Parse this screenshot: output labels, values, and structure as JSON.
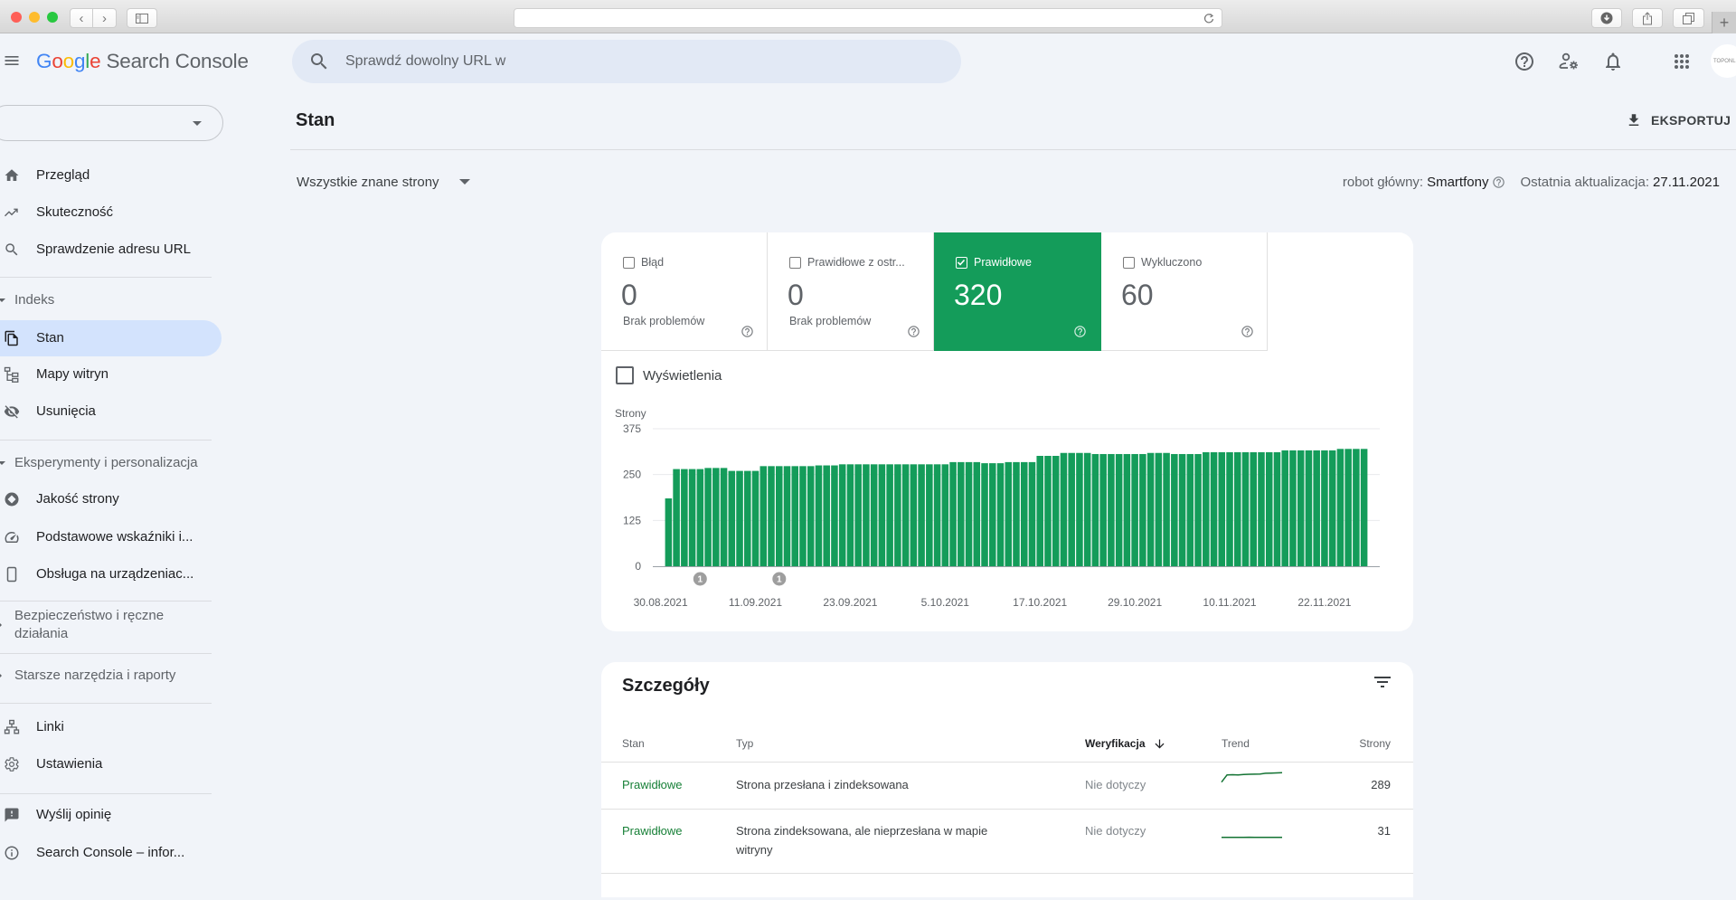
{
  "browser": {
    "address_value": "",
    "traffic_lights": {
      "close": "#fe5f57",
      "minimize": "#febc2e",
      "zoom": "#28c840"
    }
  },
  "header": {
    "logo": {
      "letters": [
        {
          "ch": "G",
          "color": "#4285f4"
        },
        {
          "ch": "o",
          "color": "#ea4335"
        },
        {
          "ch": "o",
          "color": "#fbbc05"
        },
        {
          "ch": "g",
          "color": "#4285f4"
        },
        {
          "ch": "l",
          "color": "#34a853"
        },
        {
          "ch": "e",
          "color": "#ea4335"
        }
      ],
      "product": "Search Console"
    },
    "search": {
      "placeholder": "Sprawdź dowolny URL w",
      "value": ""
    },
    "icons": [
      "help-icon",
      "manage-accounts-icon",
      "notifications-icon",
      "apps-icon"
    ],
    "avatar_text": "TOPONLIN"
  },
  "sidebar": {
    "property_value": "",
    "items": [
      {
        "label": "Przegląd",
        "icon": "home-icon"
      },
      {
        "label": "Skuteczność",
        "icon": "performance-icon"
      },
      {
        "label": "Sprawdzenie adresu URL",
        "icon": "search-icon"
      },
      {
        "label": "Stan",
        "icon": "coverage-icon",
        "active": true
      },
      {
        "label": "Mapy witryn",
        "icon": "sitemap-icon"
      },
      {
        "label": "Usunięcia",
        "icon": "removals-icon"
      },
      {
        "label": "Jakość strony",
        "icon": "page-experience-icon"
      },
      {
        "label": "Podstawowe wskaźniki i...",
        "icon": "core-web-vitals-icon"
      },
      {
        "label": "Obsługa na urządzeniac...",
        "icon": "mobile-icon"
      },
      {
        "label": "Linki",
        "icon": "links-icon"
      },
      {
        "label": "Ustawienia",
        "icon": "settings-icon"
      },
      {
        "label": "Wyślij opinię",
        "icon": "feedback-icon"
      },
      {
        "label": "Search Console – infor...",
        "icon": "info-icon"
      }
    ],
    "sections": [
      {
        "title": "Indeks",
        "expanded": true
      },
      {
        "title": "Eksperymenty i personalizacja",
        "expanded": true
      },
      {
        "title": "Bezpieczeństwo i ręczne działania",
        "expanded": false
      },
      {
        "title": "Starsze narzędzia i raporty",
        "expanded": false
      }
    ]
  },
  "page": {
    "title": "Stan",
    "export_label": "EKSPORTUJ",
    "filter_selected": "Wszystkie znane strony",
    "crawler_label": "robot główny:",
    "crawler_value": "Smartfony",
    "updated_label": "Ostatnia aktualizacja:",
    "updated_value": "27.11.2021"
  },
  "summary_tabs": [
    {
      "label": "Błąd",
      "value": "0",
      "sub": "Brak problemów",
      "checked": false
    },
    {
      "label": "Prawidłowe z ostr...",
      "value": "0",
      "sub": "Brak problemów",
      "checked": false
    },
    {
      "label": "Prawidłowe",
      "value": "320",
      "sub": "",
      "checked": true
    },
    {
      "label": "Wykluczono",
      "value": "60",
      "sub": "",
      "checked": false
    }
  ],
  "impressions_toggle": {
    "label": "Wyświetlenia",
    "checked": false
  },
  "colors": {
    "valid_green": "#149c5a",
    "active_nav": "#d3e3fd",
    "page_bg": "#f1f4f9",
    "annotation_gray": "#9e9e9e"
  },
  "chart_data": {
    "type": "bar",
    "title": "",
    "ylabel": "Strony",
    "xlabel": "",
    "ylim": [
      0,
      375
    ],
    "yticks": [
      0,
      125,
      250,
      375
    ],
    "grid": true,
    "series_name": "Prawidłowe",
    "x": [
      "2021-08-31",
      "2021-09-01",
      "2021-09-02",
      "2021-09-03",
      "2021-09-04",
      "2021-09-05",
      "2021-09-06",
      "2021-09-07",
      "2021-09-08",
      "2021-09-09",
      "2021-09-10",
      "2021-09-11",
      "2021-09-12",
      "2021-09-13",
      "2021-09-14",
      "2021-09-15",
      "2021-09-16",
      "2021-09-17",
      "2021-09-18",
      "2021-09-19",
      "2021-09-20",
      "2021-09-21",
      "2021-09-22",
      "2021-09-23",
      "2021-09-24",
      "2021-09-25",
      "2021-09-26",
      "2021-09-27",
      "2021-09-28",
      "2021-09-29",
      "2021-09-30",
      "2021-10-01",
      "2021-10-02",
      "2021-10-03",
      "2021-10-04",
      "2021-10-05",
      "2021-10-06",
      "2021-10-07",
      "2021-10-08",
      "2021-10-09",
      "2021-10-10",
      "2021-10-11",
      "2021-10-12",
      "2021-10-13",
      "2021-10-14",
      "2021-10-15",
      "2021-10-16",
      "2021-10-17",
      "2021-10-18",
      "2021-10-19",
      "2021-10-20",
      "2021-10-21",
      "2021-10-22",
      "2021-10-23",
      "2021-10-24",
      "2021-10-25",
      "2021-10-26",
      "2021-10-27",
      "2021-10-28",
      "2021-10-29",
      "2021-10-30",
      "2021-10-31",
      "2021-11-01",
      "2021-11-02",
      "2021-11-03",
      "2021-11-04",
      "2021-11-05",
      "2021-11-06",
      "2021-11-07",
      "2021-11-08",
      "2021-11-09",
      "2021-11-10",
      "2021-11-11",
      "2021-11-12",
      "2021-11-13",
      "2021-11-14",
      "2021-11-15",
      "2021-11-16",
      "2021-11-17",
      "2021-11-18",
      "2021-11-19",
      "2021-11-20",
      "2021-11-21",
      "2021-11-22",
      "2021-11-23",
      "2021-11-24",
      "2021-11-25",
      "2021-11-26",
      "2021-11-27"
    ],
    "values": [
      185,
      265,
      265,
      265,
      265,
      268,
      268,
      268,
      260,
      260,
      260,
      260,
      273,
      273,
      273,
      273,
      273,
      273,
      273,
      275,
      275,
      275,
      278,
      278,
      278,
      278,
      278,
      278,
      278,
      278,
      278,
      278,
      278,
      278,
      278,
      278,
      284,
      284,
      284,
      284,
      281,
      281,
      281,
      284,
      284,
      284,
      284,
      301,
      301,
      301,
      309,
      309,
      309,
      309,
      306,
      306,
      306,
      306,
      306,
      306,
      306,
      309,
      309,
      309,
      306,
      306,
      306,
      306,
      311,
      311,
      311,
      311,
      311,
      311,
      311,
      311,
      311,
      311,
      316,
      316,
      316,
      316,
      316,
      316,
      316,
      320,
      320,
      320,
      320
    ],
    "x_ticks": [
      {
        "date": "2021-08-30",
        "label": "30.08.2021"
      },
      {
        "date": "2021-09-11",
        "label": "11.09.2021"
      },
      {
        "date": "2021-09-23",
        "label": "23.09.2021"
      },
      {
        "date": "2021-10-05",
        "label": "5.10.2021"
      },
      {
        "date": "2021-10-17",
        "label": "17.10.2021"
      },
      {
        "date": "2021-10-29",
        "label": "29.10.2021"
      },
      {
        "date": "2021-11-10",
        "label": "10.11.2021"
      },
      {
        "date": "2021-11-22",
        "label": "22.11.2021"
      }
    ],
    "annotations": [
      {
        "date": "2021-09-04",
        "label": "1"
      },
      {
        "date": "2021-09-14",
        "label": "1"
      }
    ]
  },
  "details": {
    "title": "Szczegóły",
    "columns": {
      "status": "Stan",
      "type": "Typ",
      "validation": "Weryfikacja",
      "trend": "Trend",
      "pages": "Strony"
    },
    "sort_column": "Weryfikacja",
    "sort_direction": "descending",
    "rows": [
      {
        "status": "Prawidłowe",
        "type": "Strona przesłana i zindeksowana",
        "validation": "Nie dotyczy",
        "trend": [
          150,
          255,
          258,
          256,
          262,
          265,
          266,
          268,
          280,
          282,
          285,
          289
        ],
        "pages": "289"
      },
      {
        "status": "Prawidłowe",
        "type": "Strona zindeksowana, ale nieprzesłana w mapie witryny",
        "validation": "Nie dotyczy",
        "trend": [
          30,
          30,
          29,
          29,
          30,
          32,
          30,
          30,
          30,
          31,
          31,
          31
        ],
        "pages": "31"
      }
    ]
  }
}
